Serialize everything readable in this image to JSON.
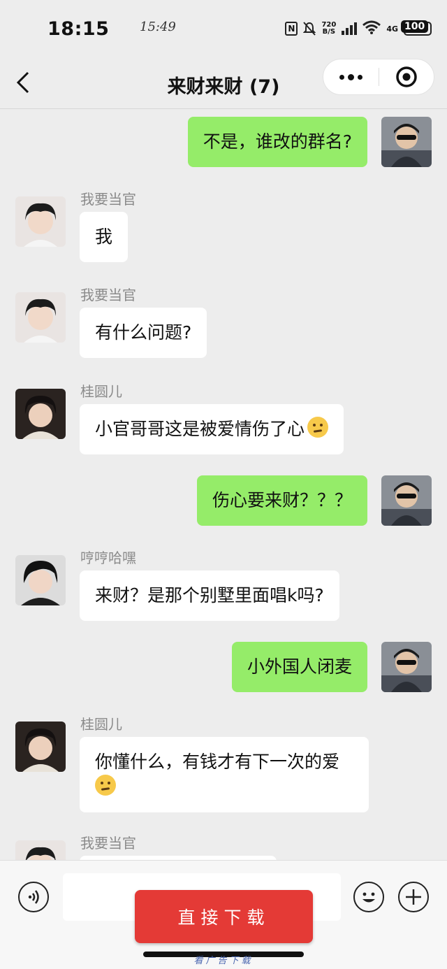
{
  "status_bar": {
    "time": "18:15",
    "handwritten_time": "15:49",
    "net_speed_value": "720",
    "net_speed_unit": "B/S",
    "network_type": "4G",
    "battery_percent": "100"
  },
  "nav": {
    "title": "来财来财 (7)"
  },
  "messages": [
    {
      "side": "out",
      "sender": "",
      "text": "不是，谁改的群名?"
    },
    {
      "side": "in",
      "sender": "我要当官",
      "text": "我"
    },
    {
      "side": "in",
      "sender": "我要当官",
      "text": "有什么问题?"
    },
    {
      "side": "in",
      "sender": "桂圆儿",
      "text": "小官哥哥这是被爱情伤了心",
      "emoji": "pleading-face-emoji"
    },
    {
      "side": "out",
      "sender": "",
      "text": "伤心要来财？？？"
    },
    {
      "side": "in",
      "sender": "哼哼哈嘿",
      "text": "来财？是那个别墅里面唱k吗?"
    },
    {
      "side": "out",
      "sender": "",
      "text": "小外国人闭麦"
    },
    {
      "side": "in",
      "sender": "桂圆儿",
      "text": "你懂什么，有钱才有下一次的爱",
      "emoji": "confused-face-emoji"
    },
    {
      "side": "in",
      "sender": "我要当官",
      "text": ""
    }
  ],
  "input_bar": {
    "ad_button_label": "直接下载",
    "ad_caption": "看广告下载"
  },
  "colors": {
    "background": "#ededed",
    "incoming_bubble": "#ffffff",
    "outgoing_bubble": "#95ec69",
    "ad_button": "#e43a36"
  }
}
